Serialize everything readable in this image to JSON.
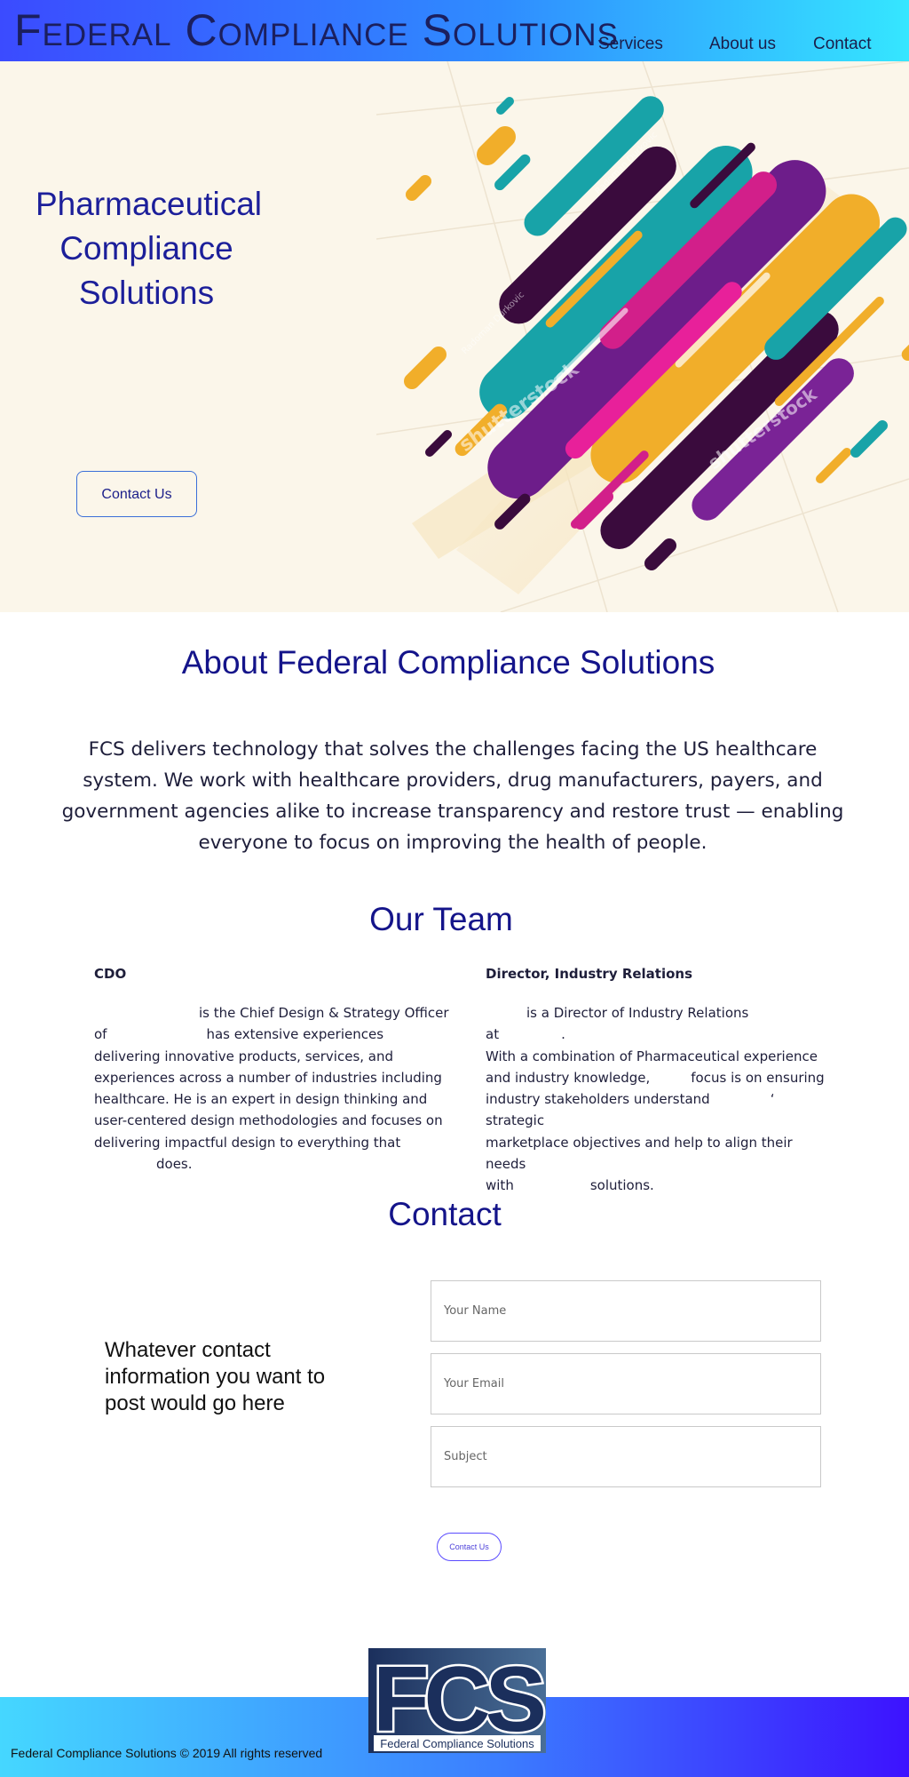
{
  "header": {
    "brand": "Federal Compliance Solutions",
    "nav": [
      "Services",
      "About us",
      "Contact"
    ]
  },
  "hero": {
    "title_lines": [
      "Pharmaceutical",
      "Compliance",
      "Solutions"
    ],
    "cta_label": "Contact Us",
    "art_watermarks": [
      "shutterstock",
      "Radoman Durkovic"
    ]
  },
  "about": {
    "title": "About Federal Compliance Solutions",
    "fcs": "FCS",
    "body": "delivers technology that solves the challenges facing the US healthcare system. We work with healthcare providers, drug manufacturers, payers, and government agencies alike to increase transparency and restore trust — enabling everyone to focus on improving the health of people."
  },
  "team": {
    "title": "Our Team",
    "members": [
      {
        "role": "CDO",
        "bio": [
          "is the Chief Design & Strategy Officer",
          "of",
          "has extensive experiences",
          "delivering innovative products, services, and",
          "experiences across a number of industries including",
          "healthcare. He is an expert in design thinking and",
          "user-centered design methodologies and focuses on",
          "delivering impactful design to everything that",
          "does."
        ]
      },
      {
        "role": "Director, Industry Relations",
        "bio": [
          "is a Director of Industry Relations at",
          ".",
          "With a combination of Pharmaceutical experience",
          "and industry knowledge,",
          "focus is on ensuring",
          "industry stakeholders understand",
          "‘ strategic",
          "marketplace objectives and help to align their needs",
          "with",
          "solutions."
        ]
      }
    ]
  },
  "contact": {
    "title": "Contact",
    "info": "Whatever contact information you want to post would go here",
    "name_placeholder": "Your Name",
    "email_placeholder": "Your Email",
    "subject_placeholder": "Subject",
    "submit_label": "Contact Us"
  },
  "footer": {
    "copyright": "Federal Compliance Solutions © 2019 All rights reserved",
    "logo_letters": "FCS",
    "logo_caption": "Federal Compliance Solutions"
  },
  "colors": {
    "header_gradient": [
      "#3b4bff",
      "#35e6ff"
    ],
    "title_navy": "#14148a",
    "hero_bg": "#fbf6ea",
    "footer_gradient": [
      "#45d7ff",
      "#3d12ff"
    ]
  }
}
